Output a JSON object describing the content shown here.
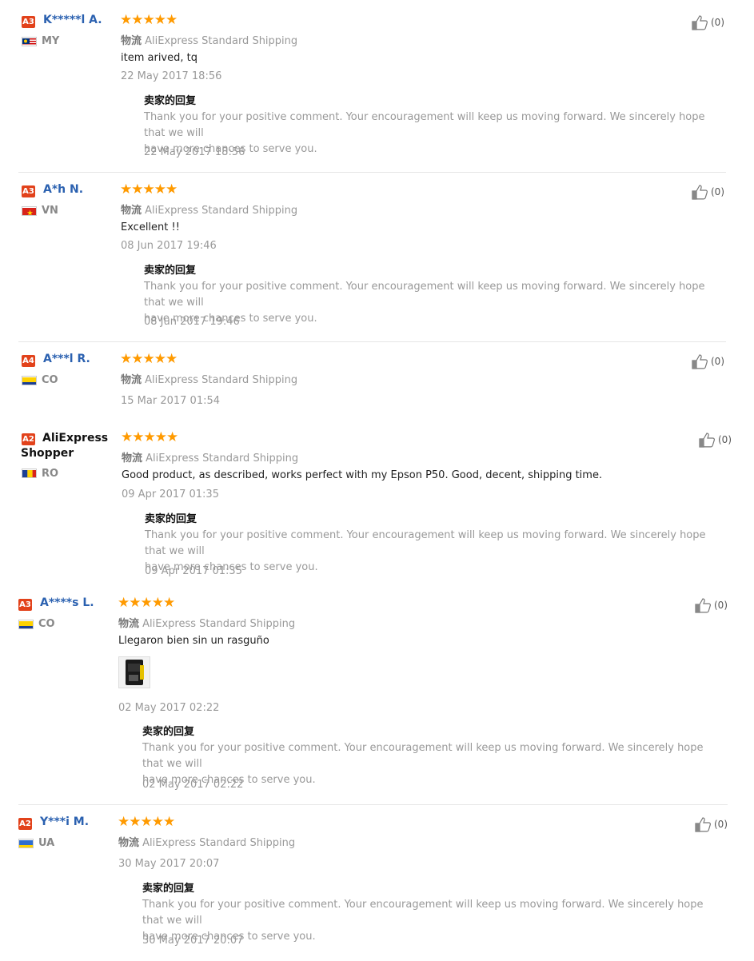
{
  "reviews": [
    {
      "badge": "A3",
      "user": "K*****l A.",
      "country": "MY",
      "flag": "my",
      "stars": "★★★★★",
      "ship_cn": "物流",
      "ship": "AliExpress Standard Shipping",
      "comment": "item arived, tq",
      "date": "22 May 2017 18:56",
      "reply_title": "卖家的回复",
      "reply_line1": "Thank you for your positive comment. Your encouragement will keep us moving forward. We sincerely hope that we will",
      "reply_line2": "have more chances to serve you.",
      "reply_date": "22 May 2017 18:56",
      "likes": "(0)"
    },
    {
      "badge": "A3",
      "user": "A*h N.",
      "country": "VN",
      "flag": "vn",
      "stars": "★★★★★",
      "ship_cn": "物流",
      "ship": "AliExpress Standard Shipping",
      "comment": "Excellent !!",
      "date": "08 Jun 2017 19:46",
      "reply_title": "卖家的回复",
      "reply_line1": "Thank you for your positive comment. Your encouragement will keep us moving forward. We sincerely hope that we will",
      "reply_line2": "have more chances to serve you.",
      "reply_date": "08 Jun 2017 19:46",
      "likes": "(0)"
    },
    {
      "badge": "A4",
      "user": "A***l R.",
      "country": "CO",
      "flag": "co",
      "stars": "★★★★★",
      "ship_cn": "物流",
      "ship": "AliExpress Standard Shipping",
      "date": "15 Mar 2017 01:54",
      "likes": "(0)"
    },
    {
      "badge": "A2",
      "user": "AliExpress Shopper",
      "country": "RO",
      "flag": "ro",
      "stars": "★★★★★",
      "ship_cn": "物流",
      "ship": "AliExpress Standard Shipping",
      "comment": "Good product, as described, works perfect with my Epson P50. Good, decent, shipping time.",
      "date": "09 Apr 2017 01:35",
      "reply_title": "卖家的回复",
      "reply_line1": "Thank you for your positive comment. Your encouragement will keep us moving forward. We sincerely hope that we will",
      "reply_line2": "have more chances to serve you.",
      "reply_date": "09 Apr 2017 01:35",
      "likes": "(0)"
    },
    {
      "badge": "A3",
      "user": "A****s L.",
      "country": "CO",
      "flag": "co",
      "stars": "★★★★★",
      "ship_cn": "物流",
      "ship": "AliExpress Standard Shipping",
      "comment": "Llegaron bien sin un rasguño",
      "date": "02 May 2017 02:22",
      "reply_title": "卖家的回复",
      "reply_line1": "Thank you for your positive comment. Your encouragement will keep us moving forward. We sincerely hope that we will",
      "reply_line2": "have more chances to serve you.",
      "reply_date": "02 May 2017 02:22",
      "likes": "(0)"
    },
    {
      "badge": "A2",
      "user": "Y***i M.",
      "country": "UA",
      "flag": "ua",
      "stars": "★★★★★",
      "ship_cn": "物流",
      "ship": "AliExpress Standard Shipping",
      "date": "30 May 2017 20:07",
      "reply_title": "卖家的回复",
      "reply_line1": "Thank you for your positive comment. Your encouragement will keep us moving forward. We sincerely hope that we will",
      "reply_line2": "have more chances to serve you.",
      "reply_date": "30 May 2017 20:07",
      "likes": "(0)"
    }
  ],
  "colors": {
    "badge": "#e2421b",
    "username": "#2b61b0",
    "stars": "#ff9a00",
    "muted": "#999999",
    "separator": "#e6e6e6"
  },
  "icons": {
    "like": "thumbs-up-icon",
    "flag": "country-flag-icon"
  }
}
